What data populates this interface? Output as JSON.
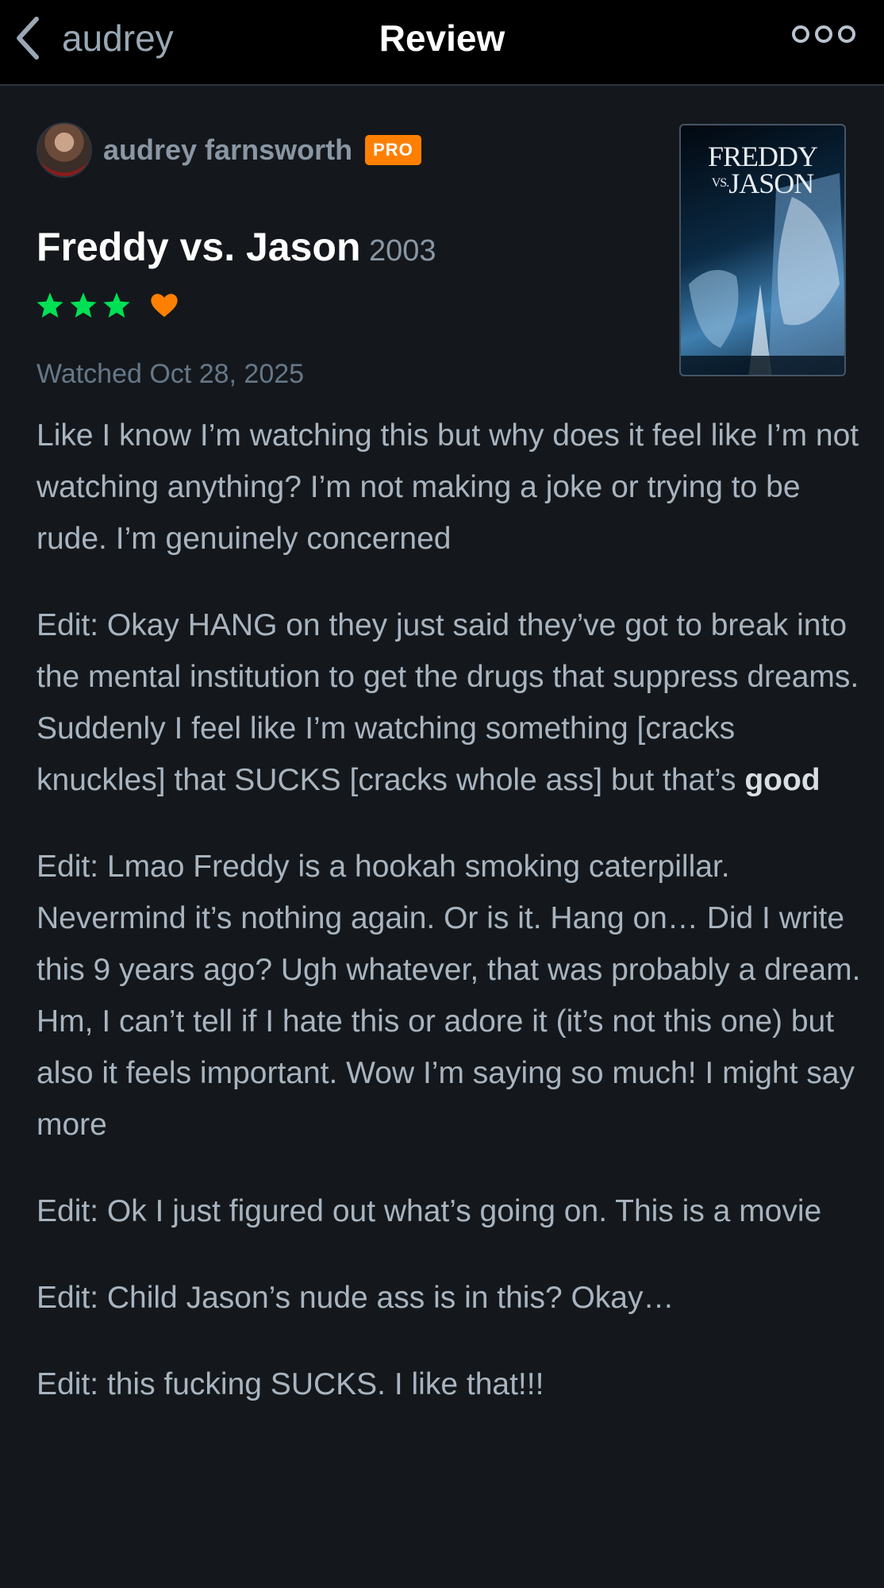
{
  "nav": {
    "back_label": "audrey",
    "title": "Review",
    "back_icon": "chevron-left-icon",
    "more_icon": "more-dots-icon"
  },
  "reviewer": {
    "name": "audrey farnsworth",
    "badge": "PRO",
    "badge_color": "#ff8000"
  },
  "film": {
    "title": "Freddy vs. Jason",
    "year": "2003",
    "poster_text_top": "FREDDY",
    "poster_text_vs": "VS.",
    "poster_text_bottom": "JASON"
  },
  "rating": {
    "stars": 3,
    "max_stars": 5,
    "liked": true,
    "star_color": "#00e054",
    "heart_color": "#ff8000"
  },
  "watched": "Watched Oct 28, 2025",
  "review": {
    "p1": "Like I know I’m watching this but why does it feel like I’m not watching anything? I’m not making a joke or trying to be rude. I’m genuinely concerned",
    "p2_text": "Edit: Okay HANG on they just said they’ve got to break into the mental institution to get the drugs that suppress dreams. Suddenly I feel like I’m watching something [cracks knuckles] that SUCKS [cracks whole ass] but that’s ",
    "p2_bold": "good",
    "p3": "Edit: Lmao Freddy is a hookah smoking caterpillar. Nevermind it’s nothing again. Or is it. Hang on… Did I write this 9 years ago? Ugh whatever, that was probably a dream. Hm, I can’t tell if I hate this or adore it (it’s not this one) but also it feels important. Wow I’m saying so much! I might say more",
    "p4": "Edit: Ok I just figured out what’s going on. This is a movie",
    "p5": "Edit: Child Jason’s nude ass is in this? Okay…",
    "p6": "Edit: this fucking SUCKS. I like that!!!"
  }
}
